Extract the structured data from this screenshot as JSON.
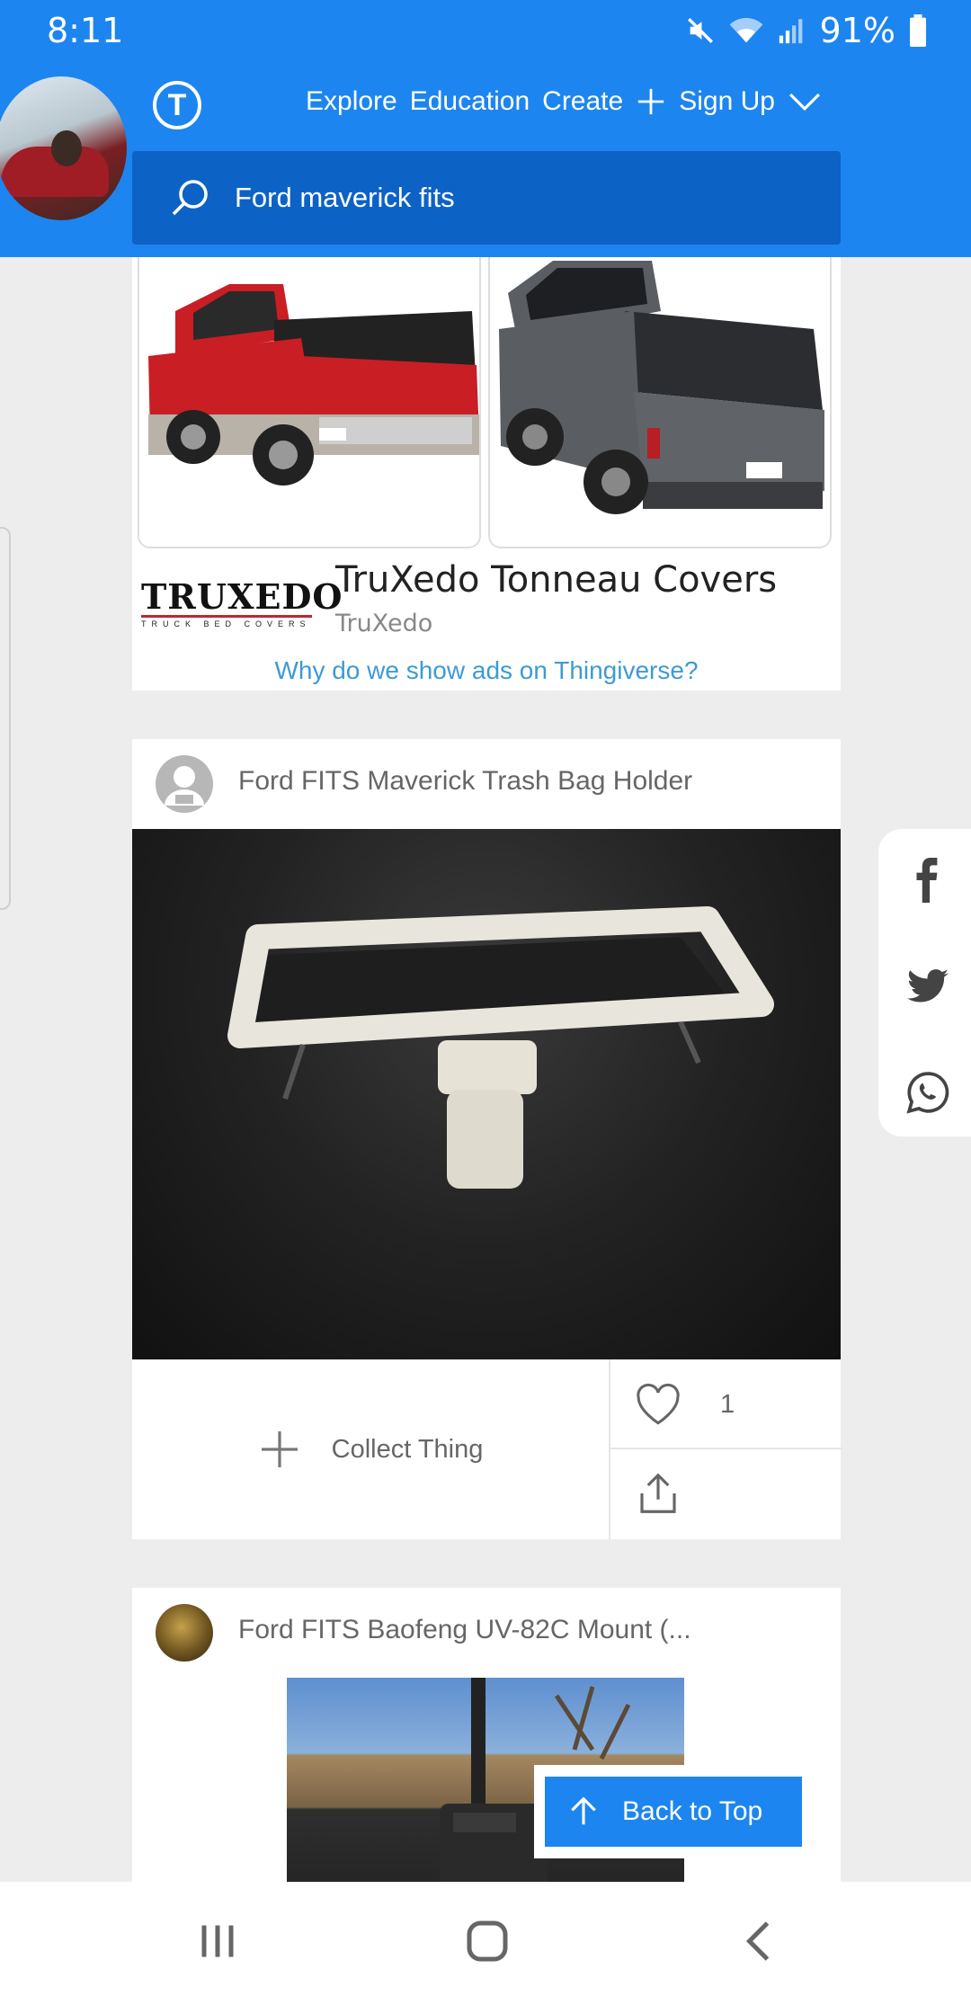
{
  "status_bar": {
    "time": "8:11",
    "battery": "91%"
  },
  "header": {
    "nav": [
      "Explore",
      "Education",
      "Create",
      "Sign Up"
    ],
    "search": {
      "value": "Ford maverick fits"
    }
  },
  "ad": {
    "title": "TruXedo Tonneau Covers",
    "advertiser": "TruXedo",
    "brand_logo_text": "TRUXEDO",
    "brand_logo_sub": "TRUCK BED COVERS",
    "why_link": "Why do we show ads on Thingiverse?"
  },
  "things": [
    {
      "title": "Ford FITS Maverick Trash Bag Holder",
      "collect_label": "Collect Thing",
      "likes": "1"
    },
    {
      "title": "Ford FITS Baofeng UV-82C Mount (..."
    }
  ],
  "back_to_top": "Back to Top",
  "colors": {
    "brand_blue": "#1d85ef",
    "search_blue": "#0d62c6",
    "link_blue": "#3d9ad6"
  }
}
